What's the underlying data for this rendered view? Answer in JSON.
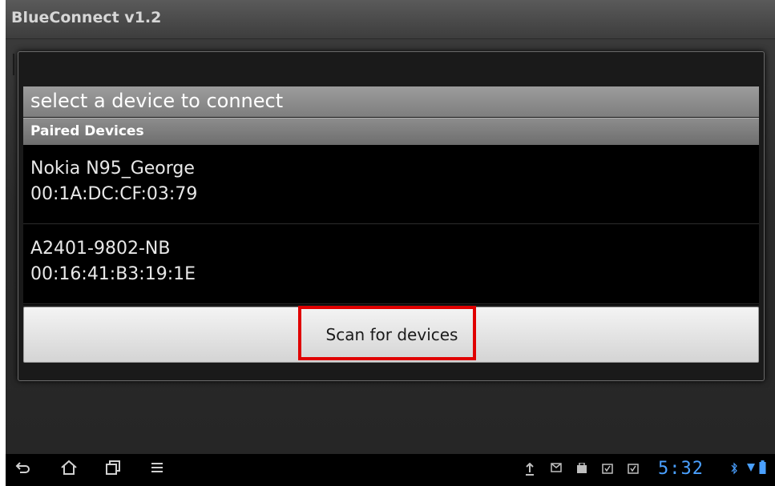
{
  "app": {
    "title": "BlueConnect v1.2"
  },
  "dialog": {
    "title": "select a device to connect",
    "section_label": "Paired Devices",
    "devices": [
      {
        "name": "Nokia N95_George",
        "address": "00:1A:DC:CF:03:79"
      },
      {
        "name": "A2401-9802-NB",
        "address": "00:16:41:B3:19:1E"
      }
    ],
    "scan_button_label": "Scan for devices",
    "highlight_color": "#e00000"
  },
  "system_bar": {
    "clock": "5:32",
    "clock_color": "#4aa0ff",
    "nav_icons": [
      "back-icon",
      "home-icon",
      "recent-apps-icon",
      "menu-icon"
    ],
    "status_icons": [
      "upload-icon",
      "email-icon",
      "notification-icon",
      "task-icon",
      "task-icon",
      "bluetooth-icon",
      "wifi-icon",
      "battery-icon"
    ]
  }
}
